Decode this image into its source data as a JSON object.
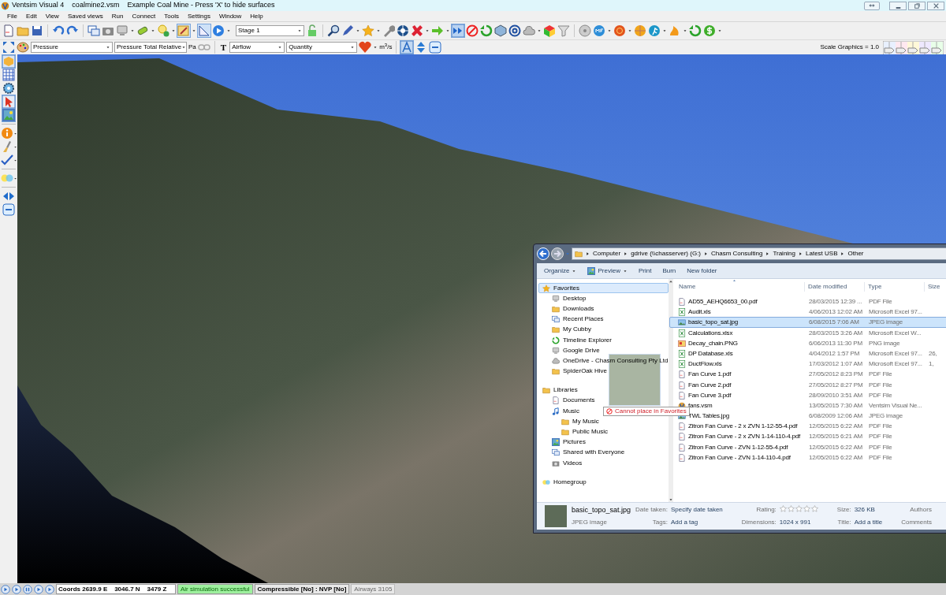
{
  "window": {
    "title": "Ventsim Visual 4",
    "file": "coalmine2.vsm",
    "subtitle": "Example Coal Mine - Press 'X' to hide surfaces"
  },
  "menu": [
    "File",
    "Edit",
    "View",
    "Saved views",
    "Run",
    "Connect",
    "Tools",
    "Settings",
    "Window",
    "Help"
  ],
  "toolbar": {
    "stage": "Stage 1",
    "color_by": "Pressure",
    "color_mode": "Pressure Total Relative",
    "color_unit": "Pa",
    "text_icon": "T",
    "text_by": "Airflow",
    "text_mode": "Quantity",
    "text_unit": "m$^{3}$/s",
    "scale_label": "Scale Graphics = 1.0"
  },
  "explorer": {
    "breadcrumb": [
      "Computer",
      "gdrive (\\\\chasserver) (G:)",
      "Chasm Consulting",
      "Training",
      "Latest USB",
      "Other"
    ],
    "commands": [
      {
        "label": "Organize",
        "menu": true
      },
      {
        "label": "Preview",
        "menu": true
      },
      {
        "label": "Print",
        "menu": false
      },
      {
        "label": "Burn",
        "menu": false
      },
      {
        "label": "New folder",
        "menu": false
      }
    ],
    "nav": [
      {
        "label": "Favorites",
        "selected": true,
        "children": [
          {
            "label": "Desktop",
            "selected": false
          },
          {
            "label": "Downloads",
            "selected": false
          },
          {
            "label": "Recent Places",
            "selected": false
          },
          {
            "label": "My Cubby",
            "selected": false
          },
          {
            "label": "Timeline Explorer",
            "selected": false
          },
          {
            "label": "Google Drive",
            "selected": false
          },
          {
            "label": "OneDrive - Chasm Consulting Pty Ltd",
            "selected": false
          },
          {
            "label": "SpiderOak Hive",
            "selected": false
          }
        ]
      },
      {
        "label": "Libraries",
        "selected": false,
        "children": [
          {
            "label": "Documents",
            "selected": false
          },
          {
            "label": "Music",
            "selected": false,
            "children": [
              {
                "label": "My Music",
                "selected": false
              },
              {
                "label": "Public Music",
                "selected": false
              }
            ]
          },
          {
            "label": "Pictures",
            "selected": false
          },
          {
            "label": "Shared with Everyone",
            "selected": false
          },
          {
            "label": "Videos",
            "selected": false
          }
        ]
      },
      {
        "label": "Homegroup",
        "selected": false
      }
    ],
    "columns": [
      "Name",
      "Date modified",
      "Type",
      "Size"
    ],
    "files": [
      {
        "name": "AD55_AEHQ6653_00.pdf",
        "date": "28/03/2015 12:39 ...",
        "type": "PDF File",
        "kind": "pdf",
        "selected": false
      },
      {
        "name": "Audit.xls",
        "date": "4/06/2013 12:02 AM",
        "type": "Microsoft Excel 97...",
        "kind": "excel",
        "selected": false
      },
      {
        "name": "basic_topo_sat.jpg",
        "date": "6/08/2015 7:06 AM",
        "type": "JPEG image",
        "kind": "image",
        "selected": true
      },
      {
        "name": "Calculations.xlsx",
        "date": "28/03/2015 3:26 AM",
        "type": "Microsoft Excel W...",
        "kind": "excel",
        "selected": false
      },
      {
        "name": "Decay_chain.PNG",
        "date": "6/06/2013 11:30 PM",
        "type": "PNG image",
        "kind": "png",
        "selected": false
      },
      {
        "name": "DP Database.xls",
        "date": "4/04/2012 1:57 PM",
        "type": "Microsoft Excel 97...",
        "size": "26,",
        "kind": "excel",
        "selected": false
      },
      {
        "name": "DuctFlow.xls",
        "date": "17/03/2012 1:07 AM",
        "type": "Microsoft Excel 97...",
        "size": "1,",
        "kind": "excel",
        "selected": false
      },
      {
        "name": "Fan Curve 1.pdf",
        "date": "27/05/2012 8:23 PM",
        "type": "PDF File",
        "kind": "pdf",
        "selected": false
      },
      {
        "name": "Fan Curve 2.pdf",
        "date": "27/05/2012 8:27 PM",
        "type": "PDF File",
        "kind": "pdf",
        "selected": false
      },
      {
        "name": "Fan Curve 3.pdf",
        "date": "28/09/2010 3:51 AM",
        "type": "PDF File",
        "kind": "pdf",
        "selected": false
      },
      {
        "name": "fans.vsm",
        "date": "13/05/2015 7:30 AM",
        "type": "Ventsim Visual Ne...",
        "kind": "vsm",
        "selected": false
      },
      {
        "name": "TWL Tables.jpg",
        "date": "6/08/2009 12:06 AM",
        "type": "JPEG image",
        "kind": "image",
        "selected": false
      },
      {
        "name": "Zitron Fan Curve - 2 x ZVN 1-12-55-4.pdf",
        "date": "12/05/2015 6:22 AM",
        "type": "PDF File",
        "kind": "pdf",
        "selected": false
      },
      {
        "name": "Zitron Fan Curve - 2 x ZVN 1-14-110-4.pdf",
        "date": "12/05/2015 6:21 AM",
        "type": "PDF File",
        "kind": "pdf",
        "selected": false
      },
      {
        "name": "Zitron Fan Curve - ZVN 1-12-55-4.pdf",
        "date": "12/05/2015 6:22 AM",
        "type": "PDF File",
        "kind": "pdf",
        "selected": false
      },
      {
        "name": "Zitron Fan Curve - ZVN 1-14-110-4.pdf",
        "date": "12/05/2015 6:22 AM",
        "type": "PDF File",
        "kind": "pdf",
        "selected": false
      }
    ],
    "drag_tooltip": "Cannot place in Favorites",
    "details": {
      "name": "basic_topo_sat.jpg",
      "type": "JPEG image",
      "columns": [
        [
          {
            "label": "Date taken:",
            "value": "Specify date taken"
          },
          {
            "label": "Tags:",
            "value": "Add a tag"
          }
        ],
        [
          {
            "label": "Rating:",
            "stars": 0
          },
          {
            "label": "Dimensions:",
            "value": "1024 x 991"
          }
        ],
        [
          {
            "label": "Size:",
            "value": "326 KB"
          },
          {
            "label": "Title:",
            "value": "Add a title"
          }
        ],
        [
          {
            "label": "Authors"
          },
          {
            "label": "Comments"
          }
        ]
      ]
    }
  },
  "status_bar": {
    "coords": "Coords 2639.9 E    3046.7 N    3479 Z",
    "simulation": "Air simulation successful",
    "compressible": "Compressible [No] : NVP [No]",
    "airways": "Airways 3105"
  }
}
